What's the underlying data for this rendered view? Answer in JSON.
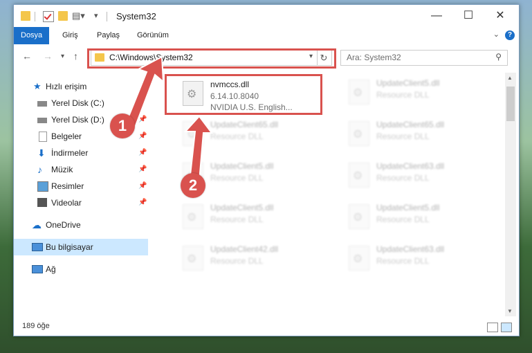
{
  "window": {
    "title": "System32"
  },
  "ribbon": {
    "tabs": [
      {
        "label": "Dosya",
        "active": true
      },
      {
        "label": "Giriş",
        "active": false
      },
      {
        "label": "Paylaş",
        "active": false
      },
      {
        "label": "Görünüm",
        "active": false
      }
    ],
    "help_label": "?"
  },
  "navigation": {
    "address_path": "C:\\Windows\\System32",
    "search_placeholder": "Ara: System32"
  },
  "sidebar": {
    "items": [
      {
        "label": "Hızlı erişim",
        "icon": "star-icon",
        "pinned": false
      },
      {
        "label": "Yerel Disk (C:)",
        "icon": "drive-icon",
        "pinned": false
      },
      {
        "label": "Yerel Disk (D:)",
        "icon": "drive-icon",
        "pinned": true
      },
      {
        "label": "Belgeler",
        "icon": "documents-icon",
        "pinned": true
      },
      {
        "label": "İndirmeler",
        "icon": "download-icon",
        "pinned": true
      },
      {
        "label": "Müzik",
        "icon": "music-icon",
        "pinned": true
      },
      {
        "label": "Resimler",
        "icon": "pictures-icon",
        "pinned": true
      },
      {
        "label": "Videolar",
        "icon": "videos-icon",
        "pinned": true
      },
      {
        "label": "OneDrive",
        "icon": "cloud-icon",
        "pinned": false
      },
      {
        "label": "Bu bilgisayar",
        "icon": "computer-icon",
        "pinned": false,
        "selected": true
      },
      {
        "label": "Ağ",
        "icon": "network-icon",
        "pinned": false
      }
    ]
  },
  "files": {
    "highlighted": {
      "name": "nvmccs.dll",
      "version": "6.14.10.8040",
      "company": "NVIDIA U.S. English..."
    },
    "others": [
      {
        "name": "UpdateClient5.dll",
        "type": "Resource DLL"
      },
      {
        "name": "UpdateClient65.dll",
        "type": "Resource DLL"
      },
      {
        "name": "UpdateClient65.dll",
        "type": "Resource DLL"
      },
      {
        "name": "UpdateClient5.dll",
        "type": "Resource DLL"
      },
      {
        "name": "UpdateClient63.dll",
        "type": "Resource DLL"
      },
      {
        "name": "UpdateClient5.dll",
        "type": "Resource DLL"
      },
      {
        "name": "UpdateClient5.dll",
        "type": "Resource DLL"
      },
      {
        "name": "UpdateClient42.dll",
        "type": "Resource DLL"
      },
      {
        "name": "UpdateClient63.dll",
        "type": "Resource DLL"
      }
    ]
  },
  "status": {
    "item_count": "189 öğe"
  },
  "callouts": {
    "step1": "1",
    "step2": "2"
  },
  "colors": {
    "accent": "#1a6fc9",
    "highlight": "#d9524e",
    "selected_bg": "#cce8ff"
  }
}
